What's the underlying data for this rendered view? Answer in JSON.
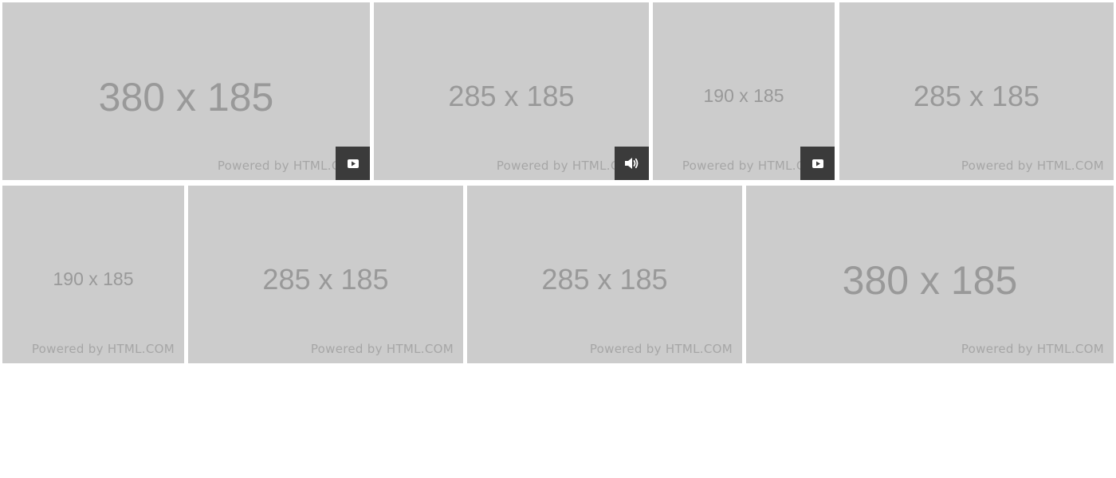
{
  "gallery": {
    "tiles": [
      {
        "dims": "380 x 185",
        "credit": "Powered by HTML.COM",
        "badge": "play-icon"
      },
      {
        "dims": "285 x 185",
        "credit": "Powered by HTML.COM",
        "badge": "volume-icon"
      },
      {
        "dims": "190 x 185",
        "credit": "Powered by HTML.COM",
        "badge": "play-icon"
      },
      {
        "dims": "285 x 185",
        "credit": "Powered by HTML.COM",
        "badge": null
      },
      {
        "dims": "190 x 185",
        "credit": "Powered by HTML.COM",
        "badge": null
      },
      {
        "dims": "285 x 185",
        "credit": "Powered by HTML.COM",
        "badge": null
      },
      {
        "dims": "285 x 185",
        "credit": "Powered by HTML.COM",
        "badge": null
      },
      {
        "dims": "380 x 185",
        "credit": "Powered by HTML.COM",
        "badge": null
      }
    ]
  },
  "colors": {
    "placeholder_bg": "#cccccc",
    "placeholder_text": "#999999",
    "badge_bg": "#3b3b3b",
    "badge_icon": "#ffffff"
  }
}
